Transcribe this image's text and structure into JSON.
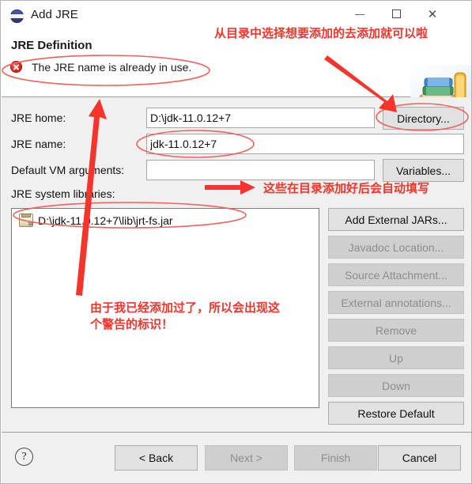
{
  "window": {
    "title": "Add JRE",
    "icon": "eclipse-jre-icon",
    "controls": {
      "minimize": "–",
      "maximize": "□",
      "close": "✕"
    }
  },
  "header": {
    "title": "JRE Definition",
    "error_icon": "error-icon",
    "error_message": "The JRE name is already in use.",
    "banner_icon": "books-stack-image"
  },
  "form": {
    "jre_home": {
      "label": "JRE home:",
      "value": "D:\\jdk-11.0.12+7",
      "placeholder": "",
      "button": "Directory..."
    },
    "jre_name": {
      "label": "JRE name:",
      "value": "jdk-11.0.12+7",
      "placeholder": ""
    },
    "vm_args": {
      "label": "Default VM arguments:",
      "value": "",
      "placeholder": "",
      "button": "Variables..."
    },
    "system_libraries": {
      "label": "JRE system libraries:",
      "items": [
        {
          "icon": "jar-file-icon",
          "path": "D:\\jdk-11.0.12+7\\lib\\jrt-fs.jar"
        }
      ]
    }
  },
  "side_buttons": [
    {
      "label": "Add External JARs...",
      "enabled": true
    },
    {
      "label": "Javadoc Location...",
      "enabled": false
    },
    {
      "label": "Source Attachment...",
      "enabled": false
    },
    {
      "label": "External annotations...",
      "enabled": false
    },
    {
      "label": "Remove",
      "enabled": false
    },
    {
      "label": "Up",
      "enabled": false
    },
    {
      "label": "Down",
      "enabled": false
    },
    {
      "label": "Restore Default",
      "enabled": true
    }
  ],
  "footer": {
    "help_icon": "?",
    "buttons": [
      {
        "label": "< Back",
        "enabled": true
      },
      {
        "label": "Next >",
        "enabled": false
      },
      {
        "label": "Finish",
        "enabled": false
      },
      {
        "label": "Cancel",
        "enabled": true
      }
    ]
  },
  "annotations": {
    "color": "#f5342c",
    "note_top": "从目录中选择想要添加的去添加就可以啦",
    "note_middle": "这些在目录添加好后会自动填写",
    "note_bottom": "由于我已经添加过了，所以会出现这个警告的标识！"
  }
}
